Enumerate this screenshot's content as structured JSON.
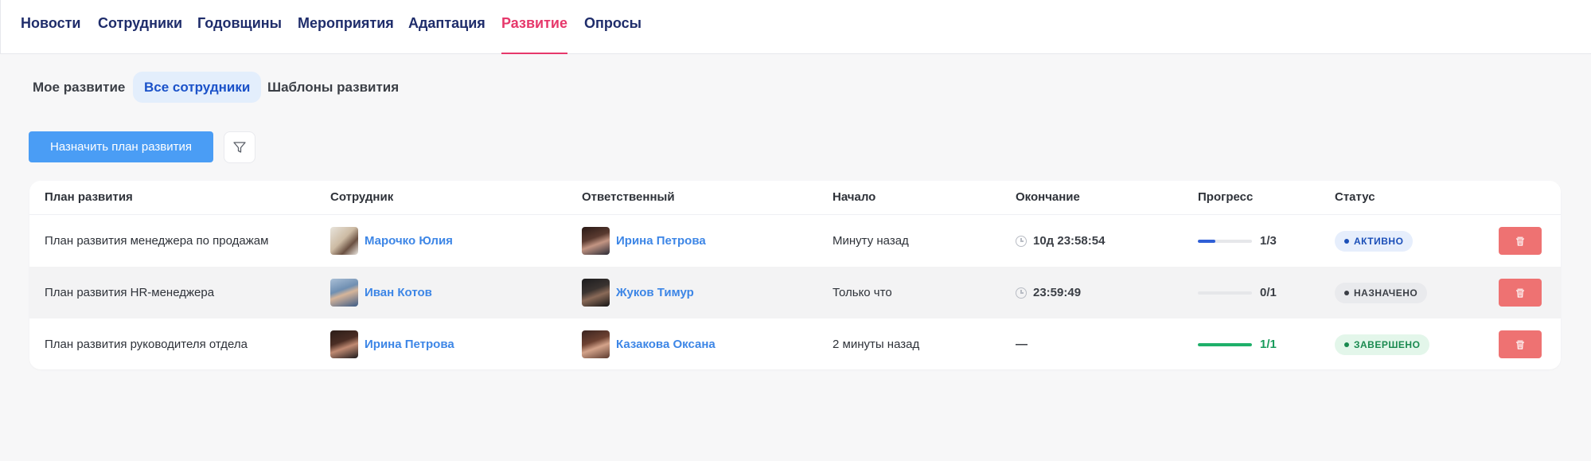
{
  "topnav": {
    "items": [
      {
        "label": "Новости"
      },
      {
        "label": "Сотрудники"
      },
      {
        "label": "Годовщины"
      },
      {
        "label": "Мероприятия"
      },
      {
        "label": "Адаптация"
      },
      {
        "label": "Развитие",
        "active": true
      },
      {
        "label": "Опросы"
      }
    ]
  },
  "subtabs": [
    {
      "label": "Мое развитие"
    },
    {
      "label": "Все сотрудники",
      "active": true
    },
    {
      "label": "Шаблоны развития"
    }
  ],
  "actions": {
    "assign_label": "Назначить план развития",
    "filter_icon": "filter-icon"
  },
  "table": {
    "headers": {
      "plan": "План развития",
      "employee": "Сотрудник",
      "responsible": "Ответственный",
      "start": "Начало",
      "end": "Окончание",
      "progress": "Прогресс",
      "status": "Статус"
    },
    "rows": [
      {
        "plan": "План развития менеджера по продажам",
        "employee": "Марочко Юлия",
        "responsible": "Ирина Петрова",
        "start": "Минуту назад",
        "end": "10д 23:58:54",
        "progress_text": "1/3",
        "progress_fraction": 0.33,
        "progress_color": "#2f5fd6",
        "status": "АКТИВНО"
      },
      {
        "plan": "План развития HR-менеджера",
        "employee": "Иван Котов",
        "responsible": "Жуков Тимур",
        "start": "Только что",
        "end": "23:59:49",
        "progress_text": "0/1",
        "progress_fraction": 0,
        "progress_color": "#2f5fd6",
        "status": "НАЗНАЧЕНО"
      },
      {
        "plan": "План развития руководителя отдела",
        "employee": "Ирина Петрова",
        "responsible": "Казакова Оксана",
        "start": "2 минуты назад",
        "end": "—",
        "progress_text": "1/1",
        "progress_fraction": 1,
        "progress_color": "#1fb06a",
        "status": "ЗАВЕРШЕНО"
      }
    ]
  },
  "colors": {
    "brand_nav": "#1f2d6b",
    "active_nav": "#e6386b",
    "primary_button": "#4a9df5",
    "delete_button": "#ee7272",
    "link": "#3d86e6"
  }
}
